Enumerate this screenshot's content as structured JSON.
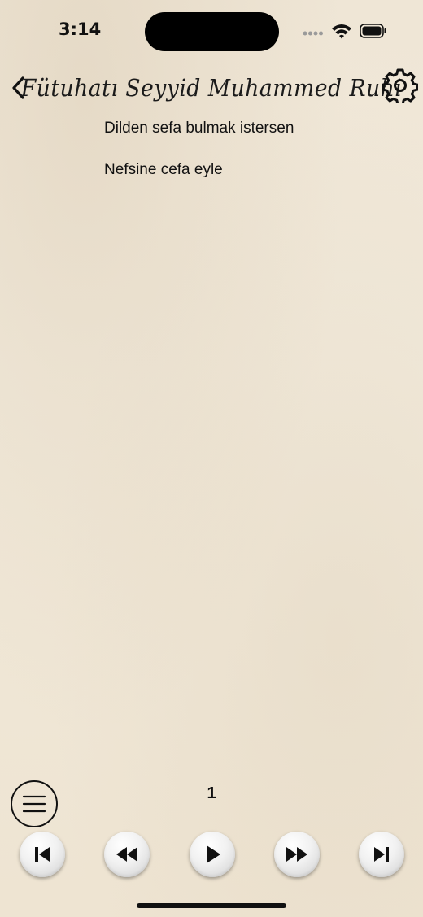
{
  "status_bar": {
    "time": "3:14",
    "icons": [
      "cellular-signal-icon",
      "wifi-icon",
      "battery-icon"
    ]
  },
  "header": {
    "back_icon": "chevron-left-icon",
    "title": "Fütuhatı Seyyid Muhammed Ruhi",
    "settings_icon": "gear-icon"
  },
  "lyrics": {
    "lines": [
      "Dilden sefa bulmak istersen",
      "Nefsine cefa eyle"
    ]
  },
  "footer": {
    "menu_icon": "hamburger-menu-icon",
    "page_number": "1",
    "controls": [
      {
        "name": "skip-back",
        "icon": "skip-to-start-icon"
      },
      {
        "name": "rewind",
        "icon": "rewind-icon"
      },
      {
        "name": "play",
        "icon": "play-icon"
      },
      {
        "name": "fast-forward",
        "icon": "fast-forward-icon"
      },
      {
        "name": "skip-forward",
        "icon": "skip-to-end-icon"
      }
    ]
  },
  "colors": {
    "background": "#f0e8d8",
    "text": "#111111",
    "button_face": "#f1f1f1"
  }
}
